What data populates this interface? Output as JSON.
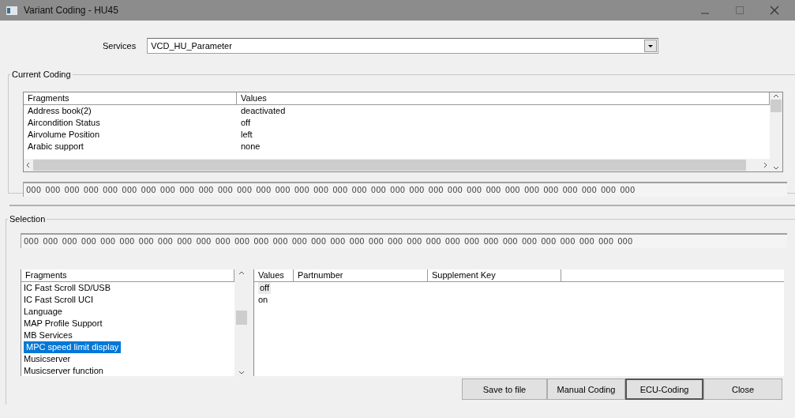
{
  "window": {
    "title": "Variant Coding - HU45"
  },
  "services": {
    "label": "Services",
    "value": "VCD_HU_Parameter"
  },
  "current_coding": {
    "title": "Current Coding",
    "columns": [
      "Fragments",
      "Values"
    ],
    "rows": [
      {
        "fragment": "Address book(2)",
        "value": "deactivated"
      },
      {
        "fragment": "Aircondition Status",
        "value": "off"
      },
      {
        "fragment": "Airvolume Position",
        "value": "left"
      },
      {
        "fragment": "Arabic support",
        "value": "none"
      }
    ],
    "coding": "000 000 000 000 000 000 000 000 000 000 000 000 000 000 000 000 000 000 000 000 000 000 000 000 000 000 000 000 000 000 000 000"
  },
  "selection": {
    "title": "Selection",
    "coding": "000 000 000 000 000 000 000 000 000 000 000 000 000 000 000 000 000 000 000 000 000 000 000 000 000 000 000 000 000 000 000 000",
    "fragments_header": "Fragments",
    "fragments": [
      {
        "label": "IC Fast Scroll SD/USB",
        "selected": false
      },
      {
        "label": "IC Fast Scroll UCI",
        "selected": false
      },
      {
        "label": "Language",
        "selected": false
      },
      {
        "label": "MAP Profile Support",
        "selected": false
      },
      {
        "label": "MB Services",
        "selected": false
      },
      {
        "label": "MPC speed limit display",
        "selected": true
      },
      {
        "label": "Musicserver",
        "selected": false
      },
      {
        "label": "Musicserver function",
        "selected": false
      }
    ],
    "value_columns": [
      "Values",
      "Partnumber",
      "Supplement Key"
    ],
    "values": [
      {
        "label": "off",
        "selected": true
      },
      {
        "label": "on",
        "selected": false
      }
    ]
  },
  "buttons": [
    {
      "label": "Save to file",
      "default": false
    },
    {
      "label": "Manual Coding",
      "default": false
    },
    {
      "label": "ECU-Coding",
      "default": true
    },
    {
      "label": "Close",
      "default": false
    }
  ]
}
